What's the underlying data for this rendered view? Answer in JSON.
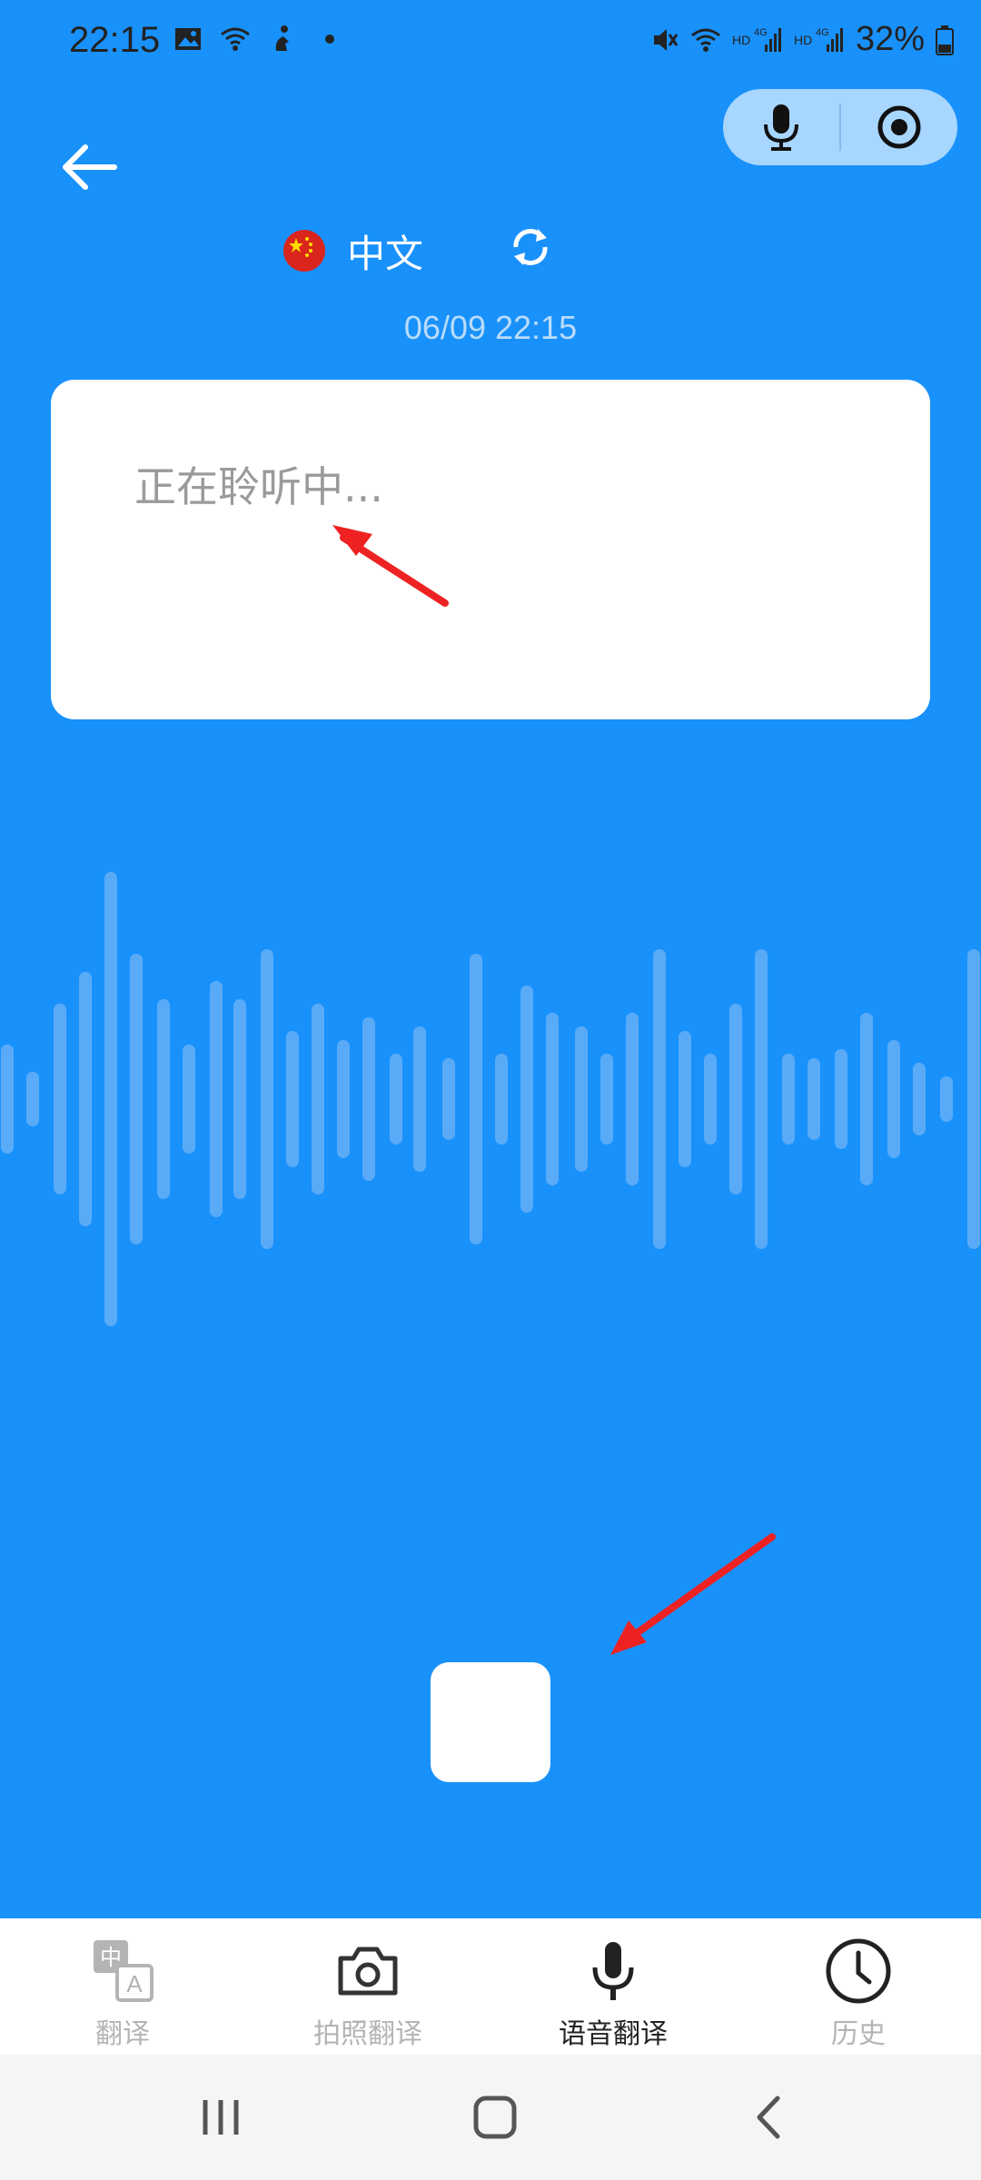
{
  "status_bar": {
    "time": "22:15",
    "left_icons": [
      "image-icon",
      "wifi-question-icon",
      "figure-icon",
      "dot-icon"
    ],
    "right_icons": [
      "mute-icon",
      "wifi-icon",
      "hd-signal-icon",
      "hd-4g-signal-icon"
    ],
    "battery_text": "32%"
  },
  "header": {
    "capsule": {
      "left_icon": "microphone-icon",
      "right_icon": "record-target-icon"
    },
    "back_icon": "arrow-left-icon"
  },
  "language": {
    "label": "中文",
    "flag_icon": "china-flag-icon",
    "swap_icon": "swap-refresh-icon"
  },
  "timestamp": "06/09 22:15",
  "card": {
    "status_text": "正在聆听中..."
  },
  "stop_button_icon": "stop-icon",
  "tabs": [
    {
      "label": "翻译",
      "icon": "translate-icon",
      "active": false
    },
    {
      "label": "拍照翻译",
      "icon": "camera-icon",
      "active": false
    },
    {
      "label": "语音翻译",
      "icon": "microphone-icon",
      "active": true
    },
    {
      "label": "历史",
      "icon": "clock-icon",
      "active": false
    }
  ],
  "colors": {
    "background": "#1991fb",
    "capsule": "#a7d6ff",
    "wave": "#5aabf7",
    "annotation_arrow": "#ee2222"
  },
  "nav_bar": {
    "icons": [
      "recents-icon",
      "home-icon",
      "back-icon"
    ]
  }
}
